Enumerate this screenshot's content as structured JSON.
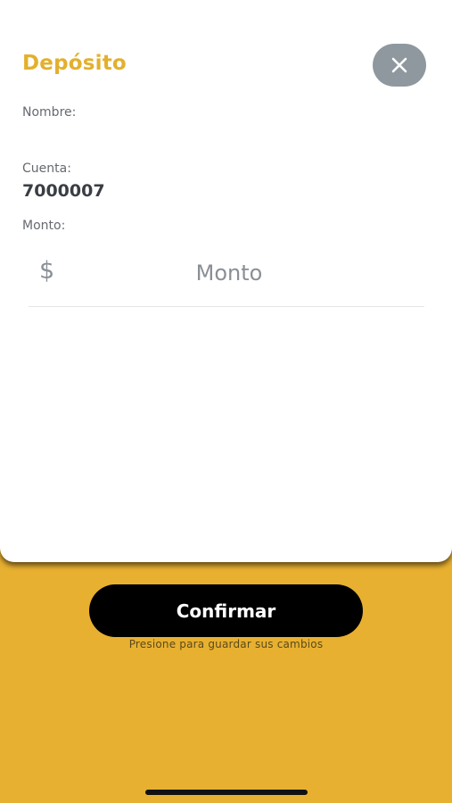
{
  "sheet": {
    "title": "Depósito",
    "close_icon": "close-icon",
    "fields": {
      "name_label": "Nombre:",
      "name_value": "",
      "account_label": "Cuenta:",
      "account_value": "7000007",
      "amount_label": "Monto:",
      "currency_symbol": "$",
      "amount_placeholder": "Monto",
      "amount_value": ""
    }
  },
  "footer": {
    "confirm_label": "Confirmar",
    "hint": "Presione para guardar sus cambios"
  },
  "colors": {
    "accent": "#E8B030",
    "title": "#E3B02E",
    "close_button": "#8F989E",
    "confirm_button": "#000000"
  }
}
